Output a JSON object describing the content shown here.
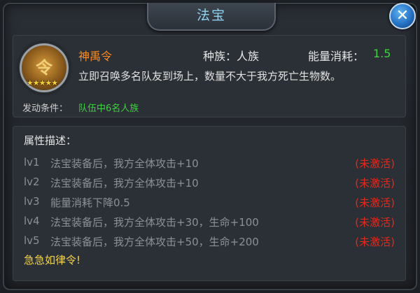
{
  "window": {
    "title": "法宝",
    "close_symbol": "✕"
  },
  "item": {
    "name": "神禹令",
    "icon_glyph": "令",
    "stars": "★★★★★",
    "race_label": "种族：人族",
    "energy_label": "能量消耗：",
    "energy_value": "1.5",
    "description": "立即召唤多名队友到场上，数量不大于我方死亡生物数。",
    "trigger_label": "发动条件：",
    "trigger_value": "队伍中6名人族"
  },
  "attributes": {
    "title": "属性描述：",
    "rows": [
      {
        "level": "lv1",
        "text": "法宝装备后，我方全体攻击+10",
        "status": "(未激活)"
      },
      {
        "level": "lv2",
        "text": "法宝装备后，我方全体攻击+10",
        "status": "(未激活)"
      },
      {
        "level": "lv3",
        "text": "能量消耗下降0.5",
        "status": "(未激活)"
      },
      {
        "level": "lv4",
        "text": "法宝装备后，我方全体攻击+30，生命+100",
        "status": "(未激活)"
      },
      {
        "level": "lv5",
        "text": "法宝装备后，我方全体攻击+50，生命+200",
        "status": "(未激活)"
      }
    ],
    "motto": "急急如律令!"
  },
  "colors": {
    "title": "#8fd3f0",
    "item_name": "#ff8a1e",
    "green": "#3fd13f",
    "inactive_red": "#e02a1f",
    "motto": "#f0d24a"
  }
}
